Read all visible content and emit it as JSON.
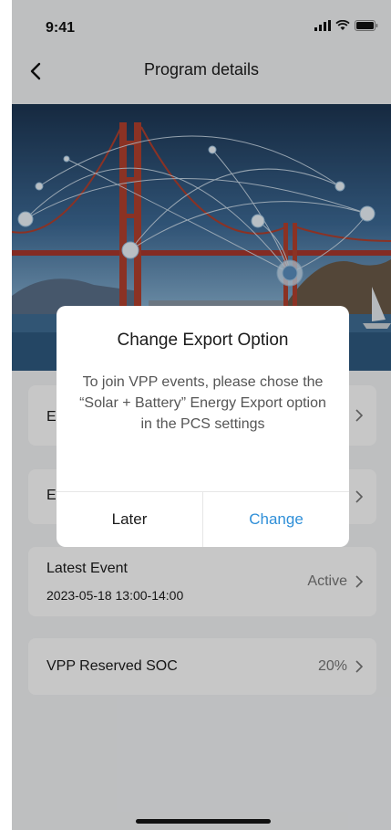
{
  "status_bar": {
    "time": "9:41",
    "icons": [
      "signal-icon",
      "wifi-icon",
      "battery-icon"
    ]
  },
  "header": {
    "title": "Program details",
    "back_icon": "chevron-left-icon"
  },
  "rows": {
    "row1_label": "Er",
    "row2_label": "Ev",
    "latest_event": {
      "label": "Latest Event",
      "time": "2023-05-18 13:00-14:00",
      "status": "Active"
    },
    "reserved_soc": {
      "label": "VPP Reserved SOC",
      "value": "20%"
    }
  },
  "dialog": {
    "title": "Change Export Option",
    "message": "To join VPP events, please chose the “Solar + Battery” Energy Export option in the PCS settings",
    "later_label": "Later",
    "change_label": "Change"
  },
  "colors": {
    "accent": "#2f8fd8",
    "background": "#f4f5f7",
    "card": "#ffffff"
  }
}
